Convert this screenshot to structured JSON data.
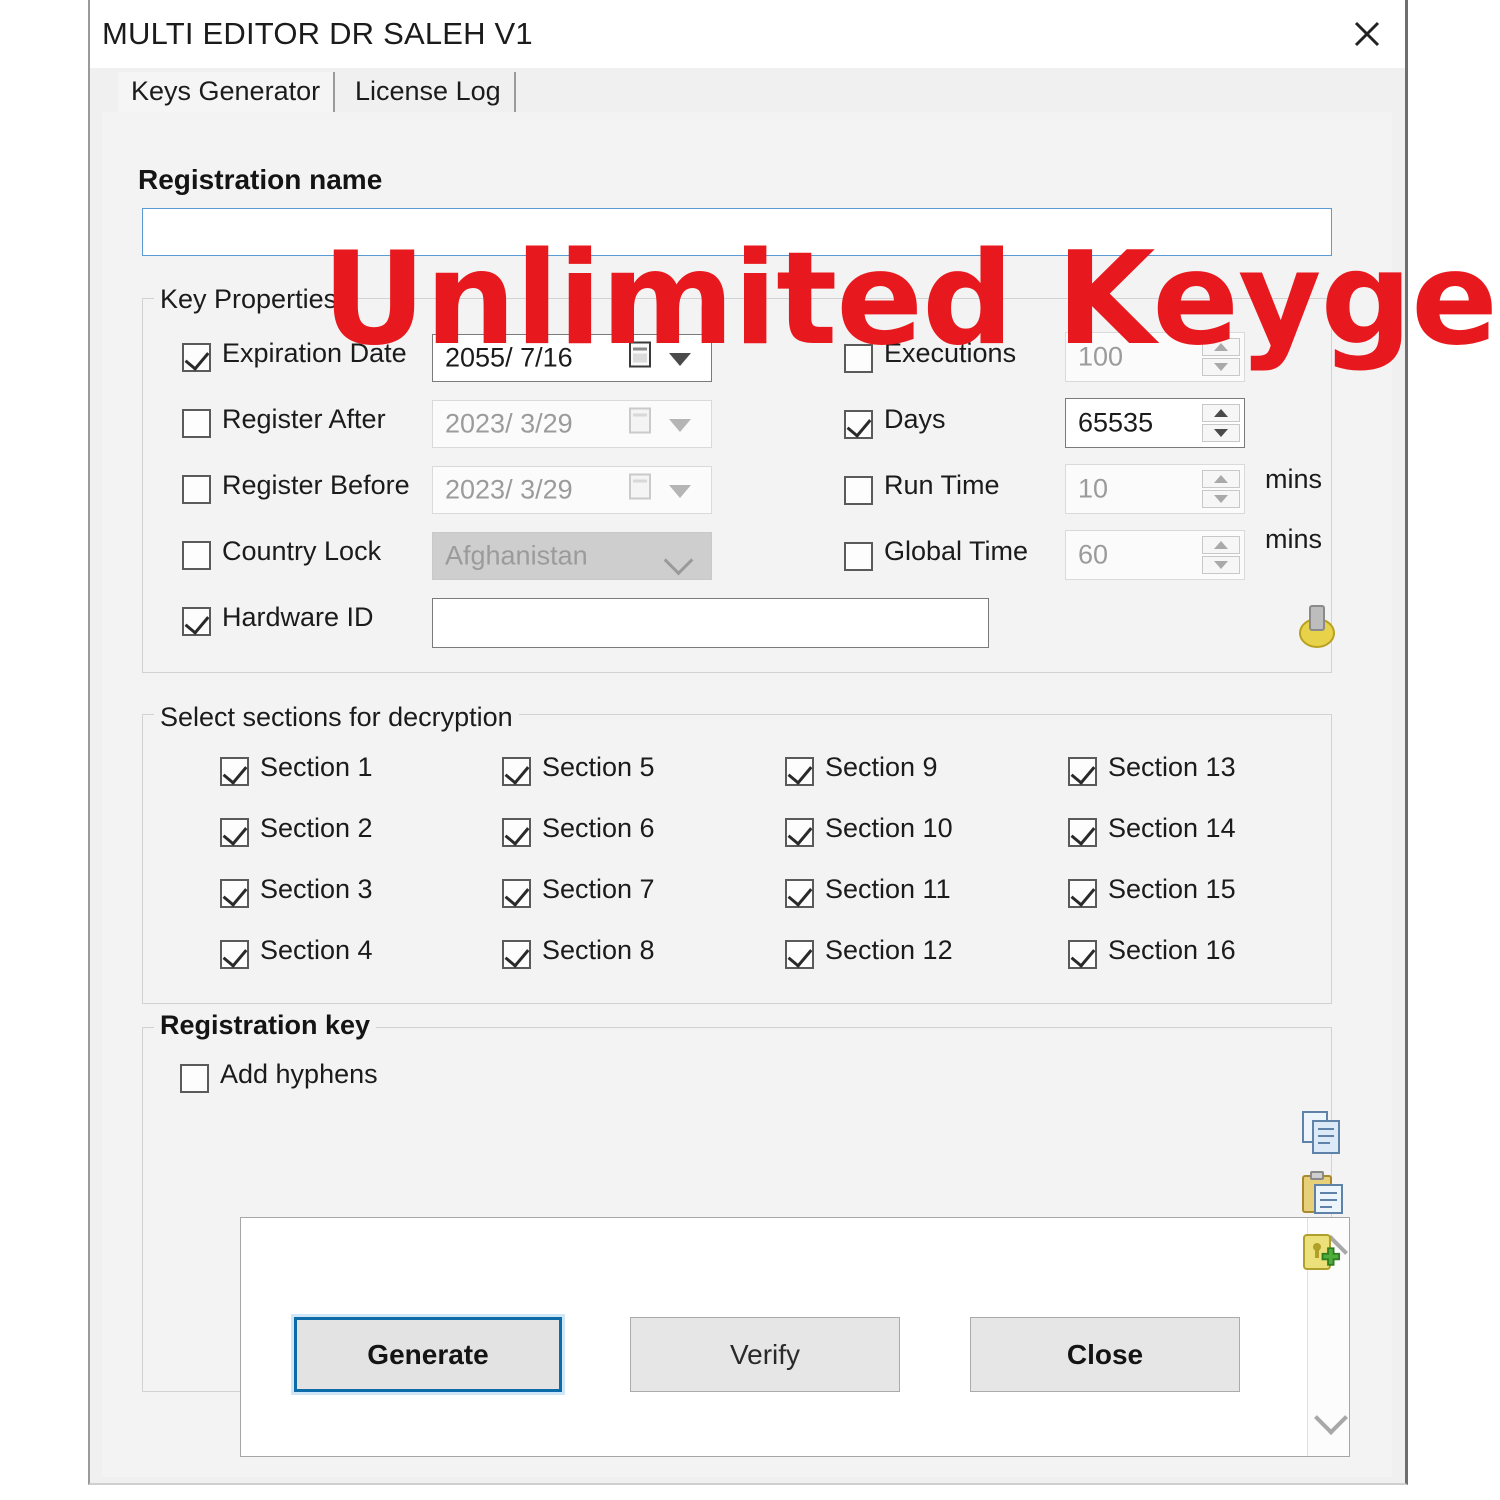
{
  "window": {
    "title": "MULTI EDITOR DR SALEH V1",
    "close_icon": "close-icon"
  },
  "tabs": [
    {
      "label": "Keys Generator",
      "active": true
    },
    {
      "label": "License Log",
      "active": false
    }
  ],
  "registration_name": {
    "label": "Registration name",
    "value": "",
    "placeholder": ""
  },
  "key_properties": {
    "group_label": "Key Properties",
    "left": [
      {
        "label": "Expiration Date",
        "checked": true,
        "value": "2055/  7/16",
        "enabled": true,
        "type": "date"
      },
      {
        "label": "Register After",
        "checked": false,
        "value": "2023/  3/29",
        "enabled": false,
        "type": "date"
      },
      {
        "label": "Register Before",
        "checked": false,
        "value": "2023/  3/29",
        "enabled": false,
        "type": "date"
      },
      {
        "label": "Country Lock",
        "checked": false,
        "value": "Afghanistan",
        "enabled": false,
        "type": "combo"
      },
      {
        "label": "Hardware ID",
        "checked": true,
        "value": "",
        "enabled": true,
        "type": "text"
      }
    ],
    "right": [
      {
        "label": "Executions",
        "checked": false,
        "value": "100",
        "enabled": false,
        "suffix": ""
      },
      {
        "label": "Days",
        "checked": true,
        "value": "65535",
        "enabled": true,
        "suffix": ""
      },
      {
        "label": "Run Time",
        "checked": false,
        "value": "10",
        "enabled": false,
        "suffix": "mins"
      },
      {
        "label": "Global Time",
        "checked": false,
        "value": "60",
        "enabled": false,
        "suffix": "mins"
      }
    ],
    "hwid_button_icon": "generate-hardware-id-icon"
  },
  "sections": {
    "group_label": "Select sections for decryption",
    "columns": [
      [
        {
          "label": "Section 1",
          "checked": true
        },
        {
          "label": "Section 2",
          "checked": true
        },
        {
          "label": "Section 3",
          "checked": true
        },
        {
          "label": "Section 4",
          "checked": true
        }
      ],
      [
        {
          "label": "Section 5",
          "checked": true
        },
        {
          "label": "Section 6",
          "checked": true
        },
        {
          "label": "Section 7",
          "checked": true
        },
        {
          "label": "Section 8",
          "checked": true
        }
      ],
      [
        {
          "label": "Section 9",
          "checked": true
        },
        {
          "label": "Section 10",
          "checked": true
        },
        {
          "label": "Section 11",
          "checked": true
        },
        {
          "label": "Section 12",
          "checked": true
        }
      ],
      [
        {
          "label": "Section 13",
          "checked": true
        },
        {
          "label": "Section 14",
          "checked": true
        },
        {
          "label": "Section 15",
          "checked": true
        },
        {
          "label": "Section 16",
          "checked": true
        }
      ]
    ]
  },
  "registration_key": {
    "group_label": "Registration key",
    "add_hyphens": {
      "label": "Add hyphens",
      "checked": false
    },
    "value": "",
    "side_icons": [
      {
        "name": "copy-icon"
      },
      {
        "name": "paste-icon"
      },
      {
        "name": "add-license-icon"
      }
    ]
  },
  "buttons": {
    "generate": "Generate",
    "verify": "Verify",
    "close": "Close"
  },
  "watermark": {
    "text": "Unlimited Keygen",
    "color": "#e8191e"
  }
}
